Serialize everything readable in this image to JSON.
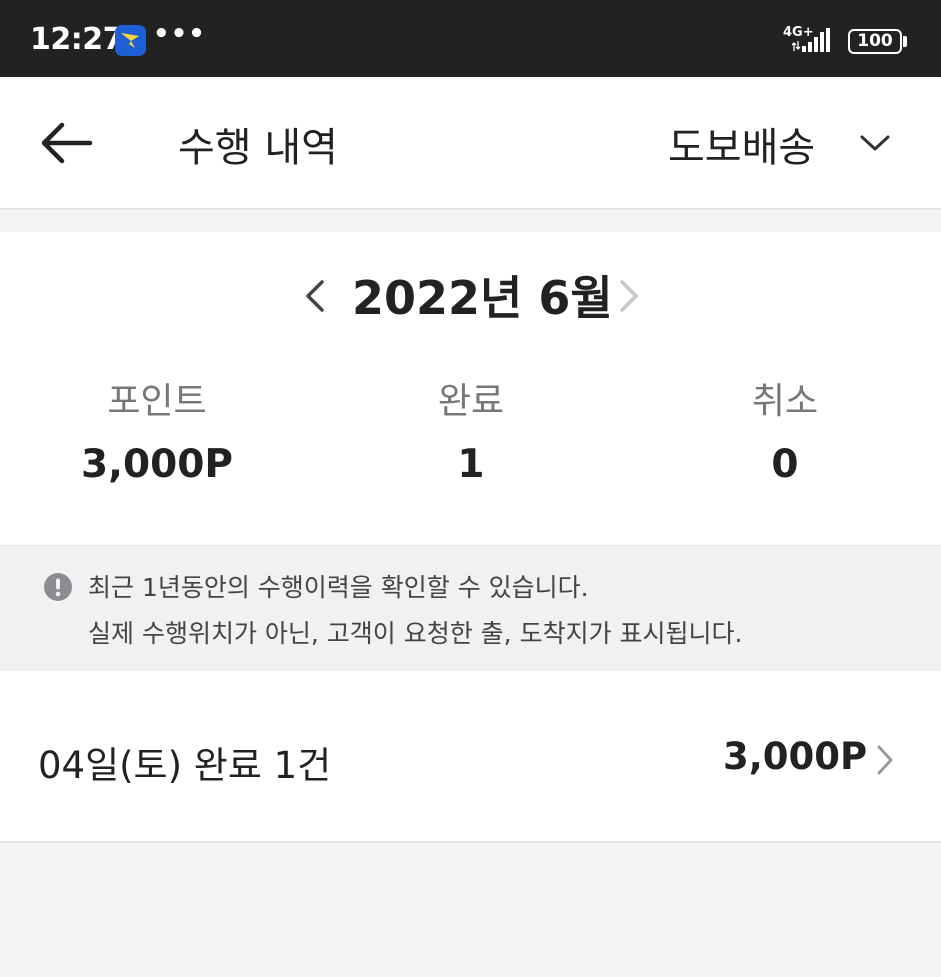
{
  "status_bar": {
    "time": "12:27",
    "dots": "•••",
    "network": "4G+",
    "battery": "100"
  },
  "header": {
    "title": "수행 내역",
    "filter_value": "도보배송"
  },
  "summary": {
    "month": "2022년 6월",
    "stats": [
      {
        "label": "포인트",
        "value": "3,000P"
      },
      {
        "label": "완료",
        "value": "1"
      },
      {
        "label": "취소",
        "value": "0"
      }
    ]
  },
  "notice": {
    "line1": "최근 1년동안의 수행이력을 확인할 수 있습니다.",
    "line2": "실제 수행위치가 아닌, 고객이 요청한 출, 도착지가 표시됩니다."
  },
  "history": [
    {
      "label": "04일(토)  완료 1건",
      "points": "3,000P"
    }
  ],
  "colors": {
    "status_bar": "#222222",
    "app_badge": "#1f5fd6",
    "background": "#f2f3f5"
  }
}
